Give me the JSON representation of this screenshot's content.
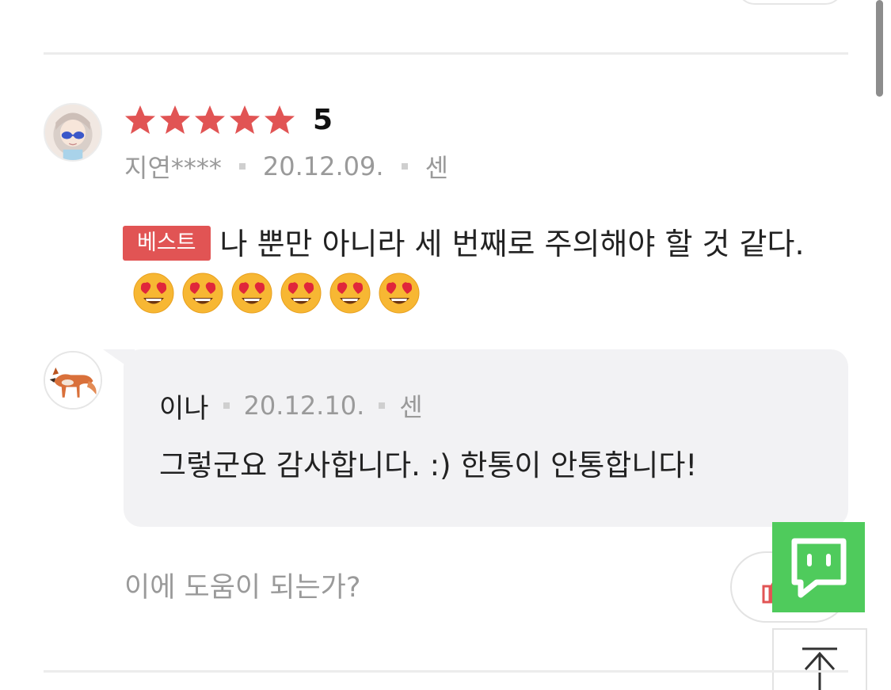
{
  "review": {
    "rating": "5",
    "stars_count": 5,
    "star_color": "#e15454",
    "reviewer": "지연****",
    "date": "20.12.09.",
    "source": "센",
    "badge": "베스트",
    "text": "나 뿐만 아니라 세 번째로 주의해야 할 것 같다.",
    "emoji_count": 6,
    "emoji": "heart-eyes-face"
  },
  "reply": {
    "author": "이나",
    "date": "20.12.10.",
    "source": "센",
    "text": "그렇군요 감사합니다. :) 한통이 안통합니다!"
  },
  "helpful": {
    "question": "이에 도움이 되는가?"
  },
  "colors": {
    "accent_red": "#e15454",
    "chat_green": "#4fcb5c",
    "reply_bg": "#f2f2f4"
  },
  "icons": {
    "chat": "chat-bubble-icon",
    "scroll_top": "arrow-up-icon",
    "like": "thumbs-up-icon"
  }
}
